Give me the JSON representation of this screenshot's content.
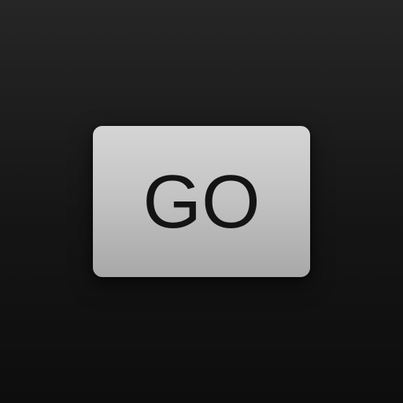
{
  "button": {
    "label": "GO"
  },
  "colors": {
    "background_top": "#262626",
    "background_bottom": "#0d0d0d",
    "button_top": "#d5d5d5",
    "button_bottom": "#a8a8a8",
    "label": "#141414"
  }
}
